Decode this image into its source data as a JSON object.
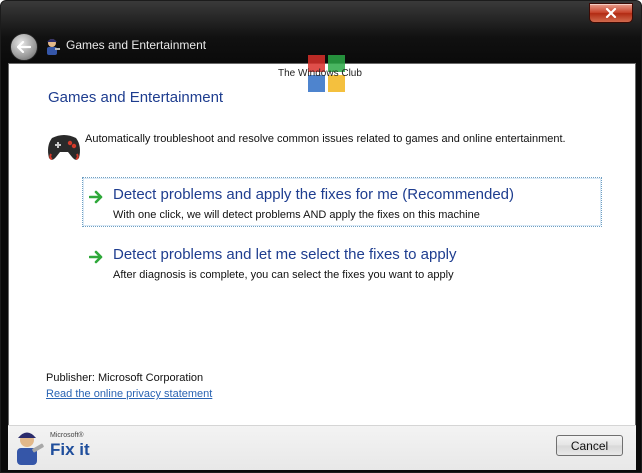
{
  "window": {
    "title": "Games and Entertainment",
    "close_icon": "close-icon",
    "back_icon": "back-arrow-icon"
  },
  "watermark": {
    "text": "The Windows Club",
    "colors": [
      "#d9302a",
      "#2aa845",
      "#2f6fc6",
      "#f2b51c"
    ]
  },
  "content": {
    "heading": "Games and Entertainment",
    "description": "Automatically troubleshoot and resolve common issues related to games and online entertainment.",
    "description_icon": "gamepad-icon",
    "options": [
      {
        "title": "Detect problems and apply the fixes for me (Recommended)",
        "subtitle": "With one click, we will detect problems AND apply the fixes on this machine",
        "selected": true,
        "icon": "green-arrow-icon"
      },
      {
        "title": "Detect problems and let me select the fixes to apply",
        "subtitle": "After diagnosis is complete, you can select the fixes you want to apply",
        "selected": false,
        "icon": "green-arrow-icon"
      }
    ],
    "publisher": "Publisher: Microsoft Corporation",
    "privacy_link": "Read the online privacy statement"
  },
  "footer": {
    "logo_small": "Microsoft®",
    "logo_big": "Fix it",
    "cancel_label": "Cancel"
  },
  "colors": {
    "heading_blue": "#1e3d8f",
    "link_blue": "#2a64b3",
    "arrow_green": "#2fa83a"
  }
}
